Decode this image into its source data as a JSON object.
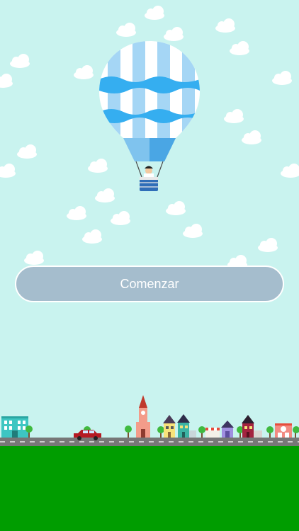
{
  "start_button": {
    "label": "Comenzar"
  },
  "colors": {
    "sky": "#c9f3ef",
    "cloud": "#ffffff",
    "balloon_light": "#a5d6f5",
    "balloon_mid": "#35aef0",
    "balloon_dark": "#1e8fd8",
    "button_fill": "#a5bdcd",
    "road": "#777777",
    "grass": "#009d00"
  },
  "icons": [
    "hot-air-balloon-icon",
    "cloud-icon",
    "car-icon",
    "house-icon",
    "church-icon",
    "tree-icon",
    "office-building-icon",
    "shop-icon"
  ]
}
